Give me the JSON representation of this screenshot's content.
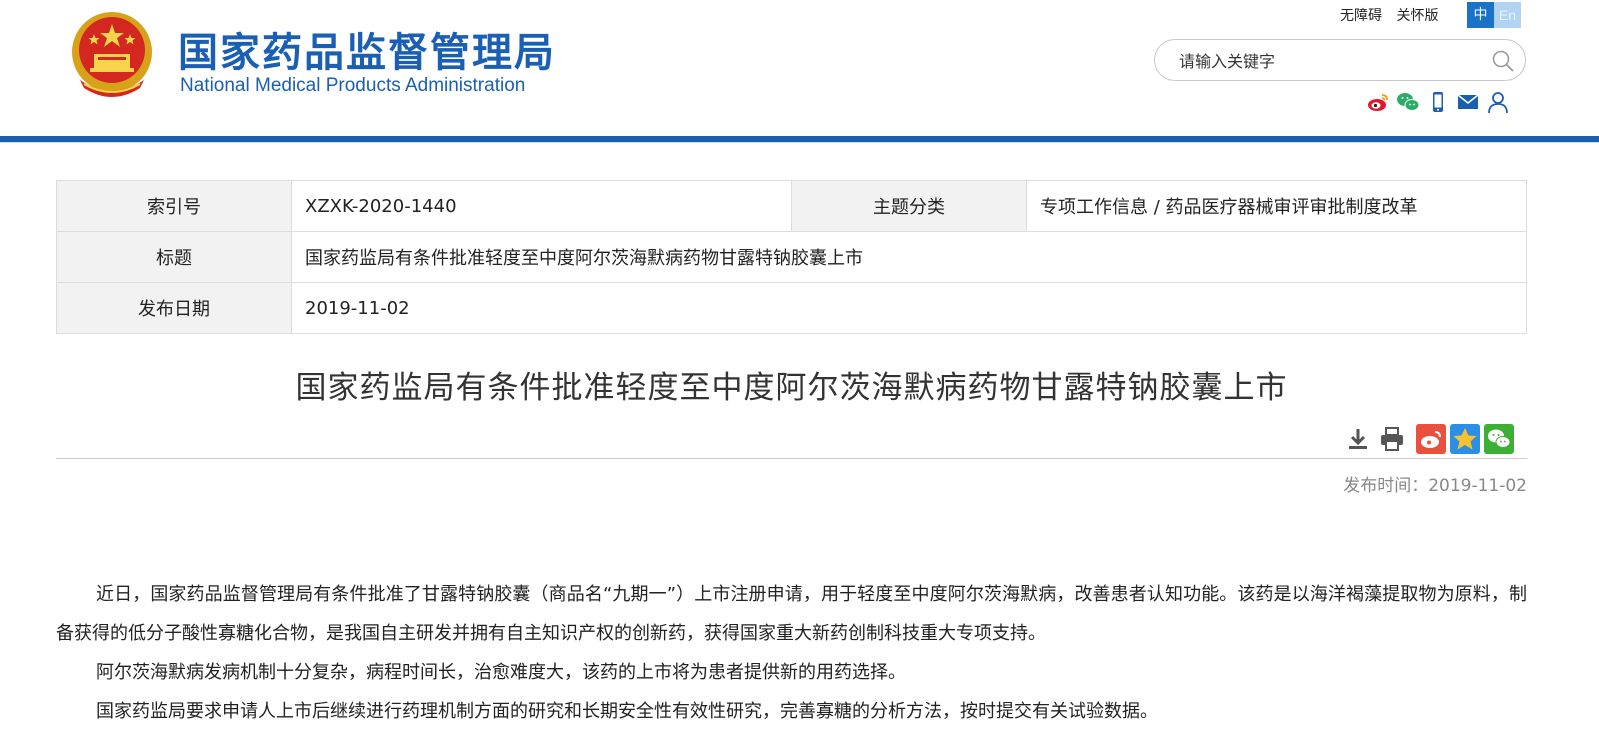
{
  "header": {
    "site_name_cn": "国家药品监督管理局",
    "site_name_en": "National Medical Products Administration",
    "top_links": [
      "无障碍",
      "关怀版"
    ],
    "lang_zh": "中",
    "lang_en": "En",
    "search_placeholder": "请输入关键字",
    "social_icons": [
      "weibo-icon",
      "wechat-icon",
      "mobile-icon",
      "mail-icon",
      "user-icon"
    ],
    "brand_color": "#1b5fb0"
  },
  "info": {
    "index_label": "索引号",
    "index_value": "XZXK-2020-1440",
    "topic_label": "主题分类",
    "topic_value": "专项工作信息 / 药品医疗器械审评审批制度改革",
    "title_label": "标题",
    "title_value": "国家药监局有条件批准轻度至中度阿尔茨海默病药物甘露特钠胶囊上市",
    "date_label": "发布日期",
    "date_value": "2019-11-02"
  },
  "article": {
    "title": "国家药监局有条件批准轻度至中度阿尔茨海默病药物甘露特钠胶囊上市",
    "pub_time_label": "发布时间：",
    "pub_time_value": "2019-11-02",
    "tools": [
      "download-icon",
      "print-icon"
    ],
    "share": [
      "weibo-share-icon",
      "favorite-star-icon",
      "wechat-share-icon"
    ],
    "paragraphs": [
      "近日，国家药品监督管理局有条件批准了甘露特钠胶囊（商品名“九期一”）上市注册申请，用于轻度至中度阿尔茨海默病，改善患者认知功能。该药是以海洋褐藻提取物为原料，制备获得的低分子酸性寡糖化合物，是我国自主研发并拥有自主知识产权的创新药，获得国家重大新药创制科技重大专项支持。",
      "阿尔茨海默病发病机制十分复杂，病程时间长，治愈难度大，该药的上市将为患者提供新的用药选择。",
      "国家药监局要求申请人上市后继续进行药理机制方面的研究和长期安全性有效性研究，完善寡糖的分析方法，按时提交有关试验数据。"
    ]
  }
}
